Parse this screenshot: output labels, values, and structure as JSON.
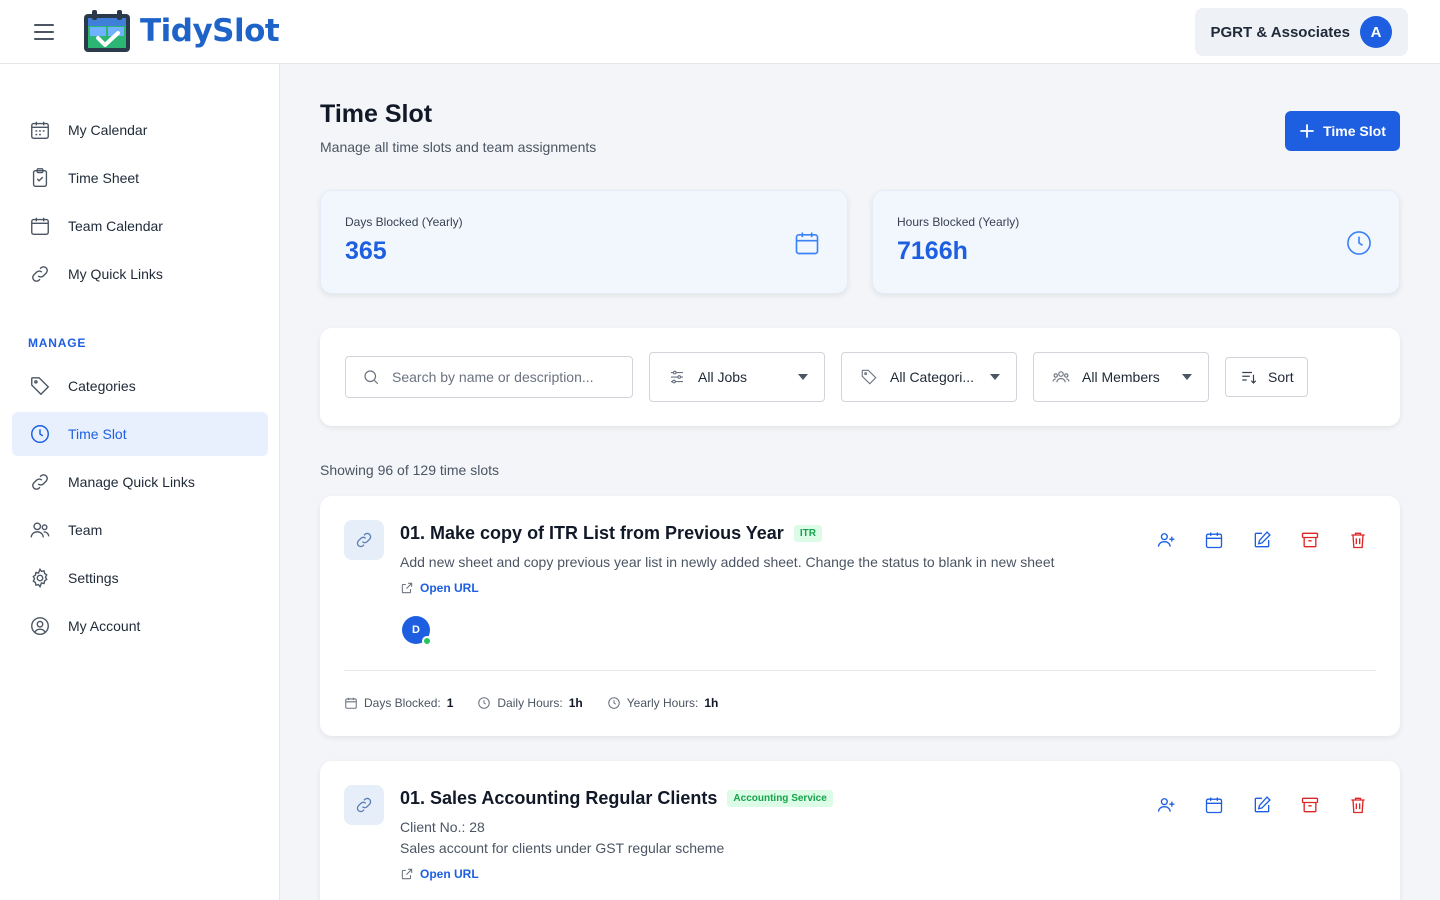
{
  "header": {
    "app_name": "TidySlot",
    "org_name": "PGRT & Associates",
    "org_initial": "A"
  },
  "sidebar": {
    "items": [
      {
        "label": "My Calendar",
        "icon": "calendar-icon"
      },
      {
        "label": "Time Sheet",
        "icon": "clipboard-check-icon"
      },
      {
        "label": "Team Calendar",
        "icon": "calendar-icon"
      },
      {
        "label": "My Quick Links",
        "icon": "link-icon"
      }
    ],
    "manage_label": "MANAGE",
    "manage_items": [
      {
        "label": "Categories",
        "icon": "tag-icon",
        "active": false
      },
      {
        "label": "Time Slot",
        "icon": "clock-icon",
        "active": true
      },
      {
        "label": "Manage Quick Links",
        "icon": "link-icon",
        "active": false
      },
      {
        "label": "Team",
        "icon": "users-icon",
        "active": false
      },
      {
        "label": "Settings",
        "icon": "gear-icon",
        "active": false
      },
      {
        "label": "My Account",
        "icon": "user-circle-icon",
        "active": false
      }
    ]
  },
  "main": {
    "title": "Time Slot",
    "subtitle": "Manage all time slots and team assignments",
    "add_button_label": "Time Slot",
    "stats": [
      {
        "label": "Days Blocked (Yearly)",
        "value": "365",
        "icon": "calendar-icon"
      },
      {
        "label": "Hours Blocked (Yearly)",
        "value": "7166h",
        "icon": "clock-icon"
      }
    ],
    "filters": {
      "search_placeholder": "Search by name or description...",
      "jobs": "All Jobs",
      "categories": "All Categori...",
      "members": "All Members",
      "sort": "Sort"
    },
    "showing_text": "Showing 96 of 129 time slots",
    "slots": [
      {
        "title": "01. Make copy of ITR List from Previous Year",
        "tag": "ITR",
        "description": "Add new sheet and copy previous year list in newly added sheet. Change the status to blank in new sheet",
        "open_url": "Open URL",
        "member_initial": "D",
        "days_blocked_label": "Days Blocked:",
        "days_blocked": "1",
        "daily_hours_label": "Daily Hours:",
        "daily_hours": "1h",
        "yearly_hours_label": "Yearly Hours:",
        "yearly_hours": "1h"
      },
      {
        "title": "01. Sales Accounting Regular Clients",
        "tag": "Accounting Service",
        "client_no": "Client No.: 28",
        "description": "Sales account for clients under GST regular scheme",
        "open_url": "Open URL"
      }
    ]
  },
  "colors": {
    "accent": "#1d5fe0",
    "danger": "#dc2626",
    "tag_green": "#16a34a"
  }
}
